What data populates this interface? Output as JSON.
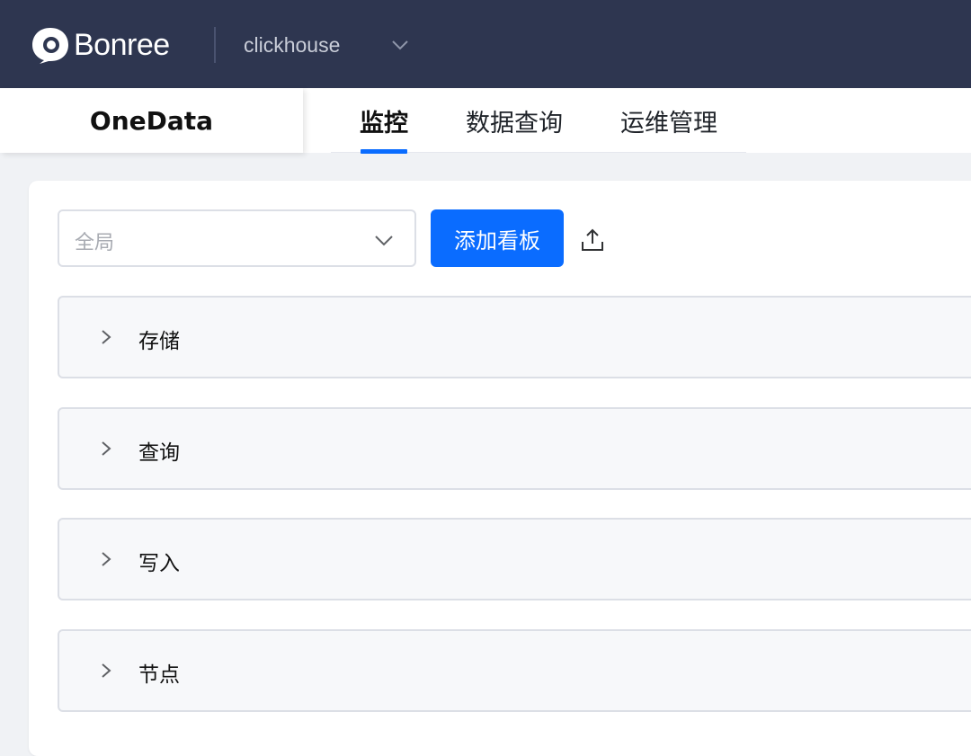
{
  "header": {
    "logo_text": "Bonree",
    "cluster": "clickhouse",
    "icons": {
      "logo": "bonree-logo-icon",
      "cluster_dropdown": "chevron-down-icon"
    }
  },
  "subheader": {
    "brand": "OneData",
    "tabs": [
      {
        "label": "监控",
        "active": true
      },
      {
        "label": "数据查询",
        "active": false
      },
      {
        "label": "运维管理",
        "active": false
      }
    ]
  },
  "toolbar": {
    "scope_select": {
      "value": "全局",
      "icon": "chevron-down-icon"
    },
    "add_board_label": "添加看板",
    "export_icon": "upload-icon"
  },
  "panels": [
    {
      "title": "存储",
      "expanded": false
    },
    {
      "title": "查询",
      "expanded": false
    },
    {
      "title": "写入",
      "expanded": false
    },
    {
      "title": "节点",
      "expanded": false
    }
  ],
  "colors": {
    "header_bg": "#2e3650",
    "accent": "#0a6cff",
    "page_bg": "#f0f2f5",
    "panel_bg": "#f7f8fa"
  }
}
